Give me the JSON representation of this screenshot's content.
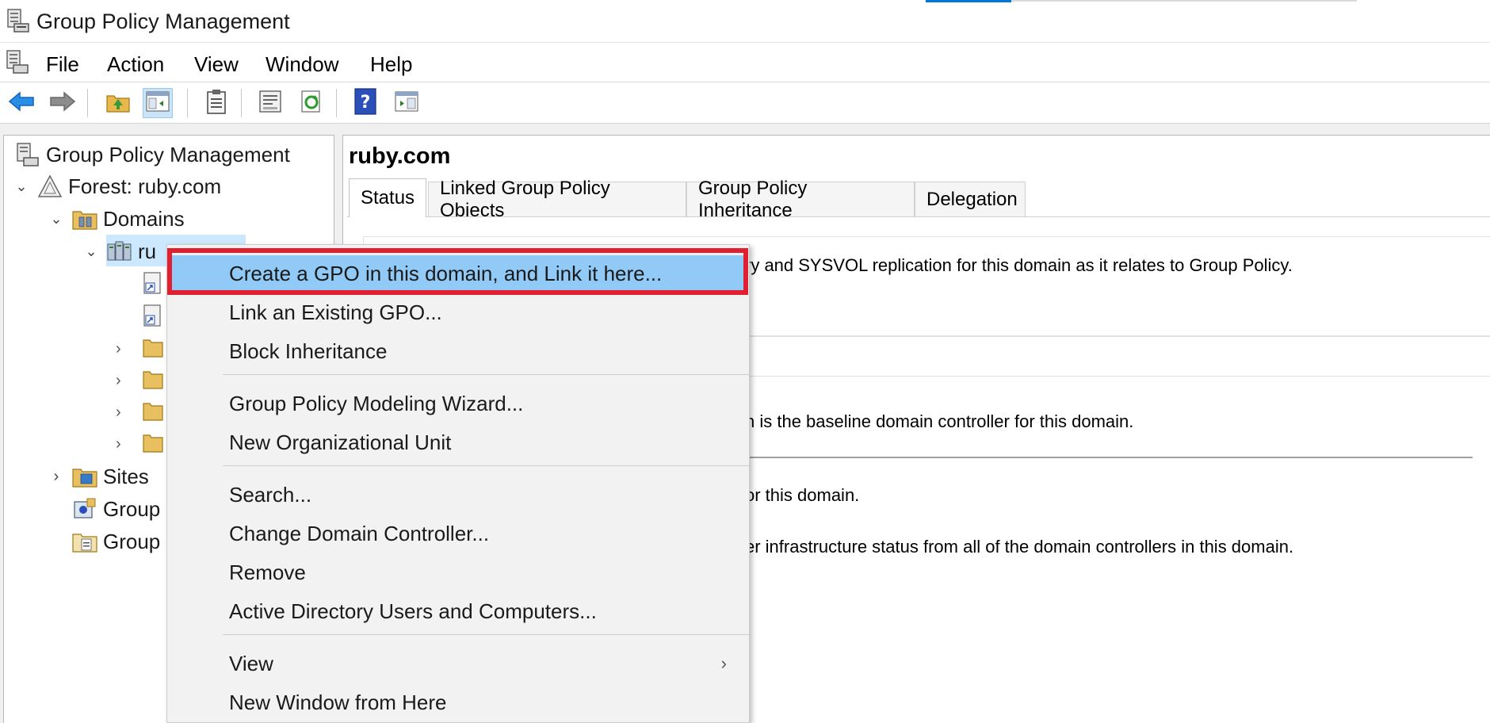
{
  "window": {
    "title": "Group Policy Management"
  },
  "menubar": {
    "items": [
      "File",
      "Action",
      "View",
      "Window",
      "Help"
    ]
  },
  "toolbar": {
    "buttons": [
      "back-arrow-icon",
      "forward-arrow-icon",
      "up-folder-icon",
      "show-hide-tree-icon",
      "clipboard-icon",
      "properties-icon",
      "refresh-icon",
      "help-icon",
      "action-pane-icon"
    ]
  },
  "tree": {
    "root": "Group Policy Management",
    "forest": "Forest: ruby.com",
    "domains": "Domains",
    "domain": "ruby.com",
    "domain_visible": "ru",
    "sites": "Sites",
    "group1_visible": "Group",
    "group2_visible": "Group"
  },
  "main": {
    "title": "ruby.com",
    "tabs": [
      {
        "label": "Status",
        "active": true
      },
      {
        "label": "Linked Group Policy Objects",
        "active": false
      },
      {
        "label": "Group Policy Inheritance",
        "active": false
      },
      {
        "label": "Delegation",
        "active": false
      }
    ],
    "lines": [
      "ry and SYSVOL replication for this domain as it relates to Group Policy.",
      "n is the baseline domain controller for this domain.",
      "or this domain.",
      "er infrastructure status from all of the domain controllers in this domain."
    ]
  },
  "context_menu": {
    "items": [
      {
        "label": "Create a GPO in this domain, and Link it here...",
        "highlighted": true
      },
      {
        "label": "Link an Existing GPO..."
      },
      {
        "label": "Block Inheritance"
      },
      {
        "label": "Group Policy Modeling Wizard..."
      },
      {
        "label": "New Organizational Unit"
      },
      {
        "label": "Search..."
      },
      {
        "label": "Change Domain Controller..."
      },
      {
        "label": "Remove"
      },
      {
        "label": "Active Directory Users and Computers..."
      },
      {
        "label": "View",
        "submenu_arrow": "›"
      },
      {
        "label": "New Window from Here"
      }
    ]
  },
  "colors": {
    "highlight": "#91c9f7",
    "annotation_frame": "#e02030",
    "selection": "#cce8ff",
    "accent": "#0078d7"
  }
}
